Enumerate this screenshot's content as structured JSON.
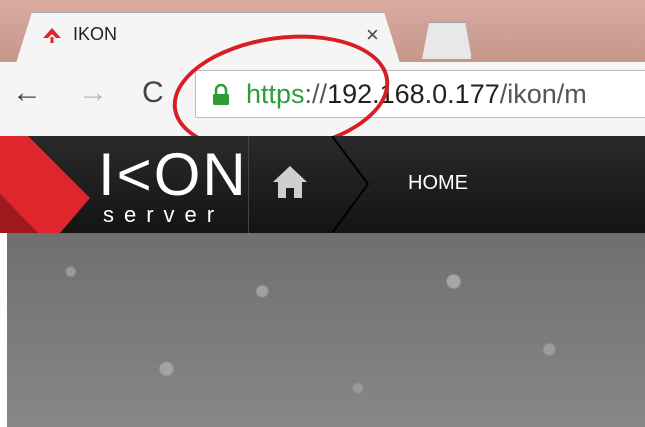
{
  "browser": {
    "tab": {
      "title": "IKON",
      "close_label": "×"
    },
    "nav": {
      "back": "←",
      "forward": "→",
      "reload": "C"
    },
    "address": {
      "scheme": "https",
      "separator": "://",
      "host": "192.168.0.177",
      "path": "/ikon/m"
    }
  },
  "site": {
    "logo_text": "I<ON",
    "logo_sub": "server",
    "nav_home_label": "HOME"
  },
  "colors": {
    "annotation": "#d71e26",
    "secure_green": "#2e9d39",
    "header_bg": "#1a1a1a",
    "brand_red": "#e0262d"
  },
  "icons": [
    "favicon-icon",
    "lock-icon",
    "home-icon"
  ]
}
